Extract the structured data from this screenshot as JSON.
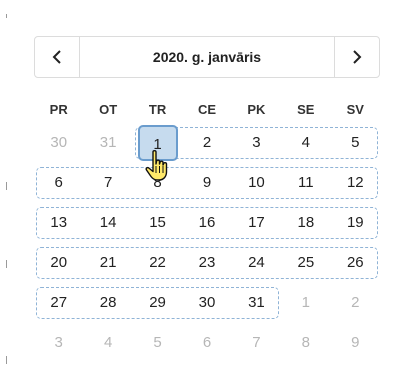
{
  "calendar": {
    "title": "2020. g. janvāris",
    "prev_icon": "chevron-left-icon",
    "next_icon": "chevron-right-icon",
    "weekdays": [
      "PR",
      "OT",
      "TR",
      "CE",
      "PK",
      "SE",
      "SV"
    ],
    "weeks": [
      [
        {
          "d": "30",
          "m": true
        },
        {
          "d": "31",
          "m": true
        },
        {
          "d": "1",
          "s": true
        },
        {
          "d": "2"
        },
        {
          "d": "3"
        },
        {
          "d": "4"
        },
        {
          "d": "5"
        }
      ],
      [
        {
          "d": "6"
        },
        {
          "d": "7"
        },
        {
          "d": "8"
        },
        {
          "d": "9"
        },
        {
          "d": "10"
        },
        {
          "d": "11"
        },
        {
          "d": "12"
        }
      ],
      [
        {
          "d": "13"
        },
        {
          "d": "14"
        },
        {
          "d": "15"
        },
        {
          "d": "16"
        },
        {
          "d": "17"
        },
        {
          "d": "18"
        },
        {
          "d": "19"
        }
      ],
      [
        {
          "d": "20"
        },
        {
          "d": "21"
        },
        {
          "d": "22"
        },
        {
          "d": "23"
        },
        {
          "d": "24"
        },
        {
          "d": "25"
        },
        {
          "d": "26"
        }
      ],
      [
        {
          "d": "27"
        },
        {
          "d": "28"
        },
        {
          "d": "29"
        },
        {
          "d": "30"
        },
        {
          "d": "31"
        },
        {
          "d": "1",
          "m": true
        },
        {
          "d": "2",
          "m": true
        }
      ],
      [
        {
          "d": "3",
          "m": true
        },
        {
          "d": "4",
          "m": true
        },
        {
          "d": "5",
          "m": true
        },
        {
          "d": "6",
          "m": true
        },
        {
          "d": "7",
          "m": true
        },
        {
          "d": "8",
          "m": true
        },
        {
          "d": "9",
          "m": true
        }
      ]
    ],
    "cursor_icon": "hand-pointer-icon"
  }
}
